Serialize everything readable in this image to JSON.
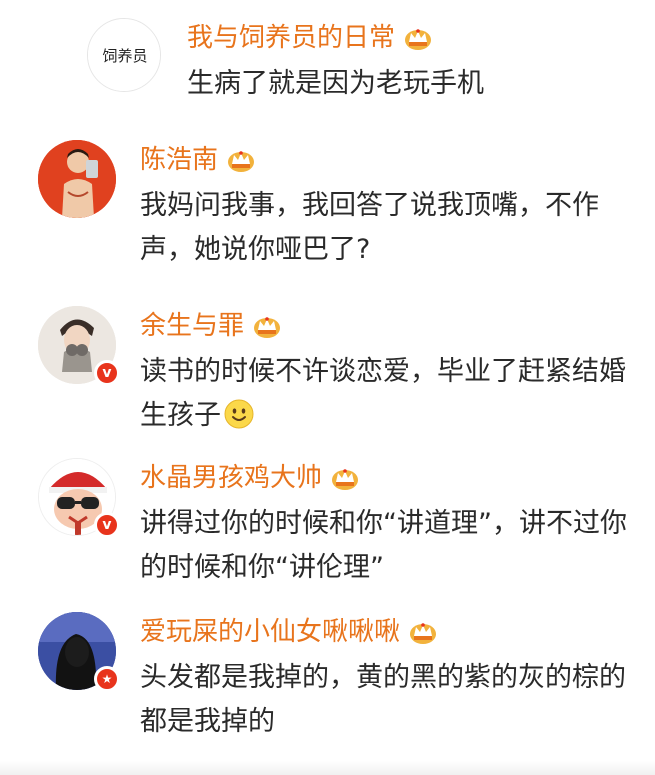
{
  "comments": [
    {
      "username": "我与饲养员的日常",
      "text": "生病了就是因为老玩手机",
      "avatar_logo_text": "饲养员",
      "verified": false
    },
    {
      "username": "陈浩南",
      "text": "我妈问我事，我回答了说我顶嘴，不作声，她说你哑巴了?",
      "verified": false
    },
    {
      "username": "余生与罪",
      "text": "读书的时候不许谈恋爱，毕业了赶紧结婚生孩子",
      "text_suffix_icon": "smiley-icon",
      "verified": true,
      "badge_glyph": "v"
    },
    {
      "username": "水晶男孩鸡大帅",
      "text": "讲得过你的时候和你“讲道理”，讲不过你的时候和你“讲伦理”",
      "verified": true,
      "badge_glyph": "v"
    },
    {
      "username": "爱玩屎的小仙女啾啾啾",
      "text": "头发都是我掉的，黄的黑的紫的灰的棕的都是我掉的",
      "verified": true,
      "badge_glyph": "★"
    }
  ],
  "icons": {
    "member_badge": "crown-icon",
    "verified_badge": "verified-badge-icon"
  },
  "colors": {
    "username": "#e8741c",
    "text": "#2a2a2a",
    "badge": "#e8341c",
    "crown": "#f2b23c"
  }
}
